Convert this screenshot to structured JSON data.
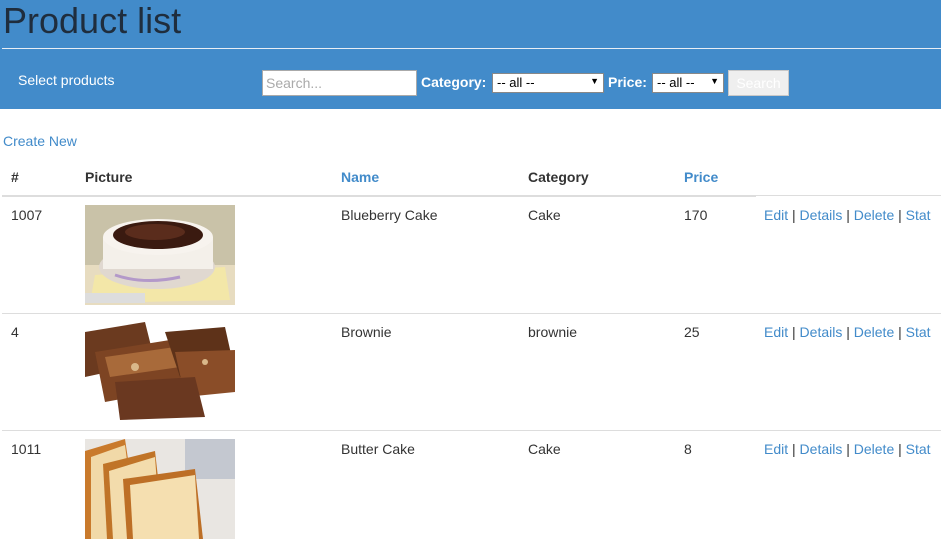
{
  "page": {
    "title": "Product list"
  },
  "toolbar": {
    "select_label": "Select products",
    "search_placeholder": "Search...",
    "category_label": "Category:",
    "category_selected": "-- all --",
    "price_label": "Price:",
    "price_selected": "-- all --",
    "search_button": "Search"
  },
  "create_new": "Create New",
  "table": {
    "columns": [
      "#",
      "Picture",
      "Name",
      "Category",
      "Price"
    ],
    "rows": [
      {
        "id": "1007",
        "name": "Blueberry Cake",
        "category": "Cake",
        "price": "170",
        "image": "cake-photo"
      },
      {
        "id": "4",
        "name": "Brownie",
        "category": "brownie",
        "price": "25",
        "image": "brownie-photo"
      },
      {
        "id": "1011",
        "name": "Butter Cake",
        "category": "Cake",
        "price": "8",
        "image": "butter-cake-photo"
      }
    ],
    "actions": {
      "edit": "Edit",
      "details": "Details",
      "delete": "Delete",
      "stat": "Stat",
      "sep": "|"
    }
  },
  "colors": {
    "header_bg": "#428bca",
    "link": "#428bca"
  }
}
